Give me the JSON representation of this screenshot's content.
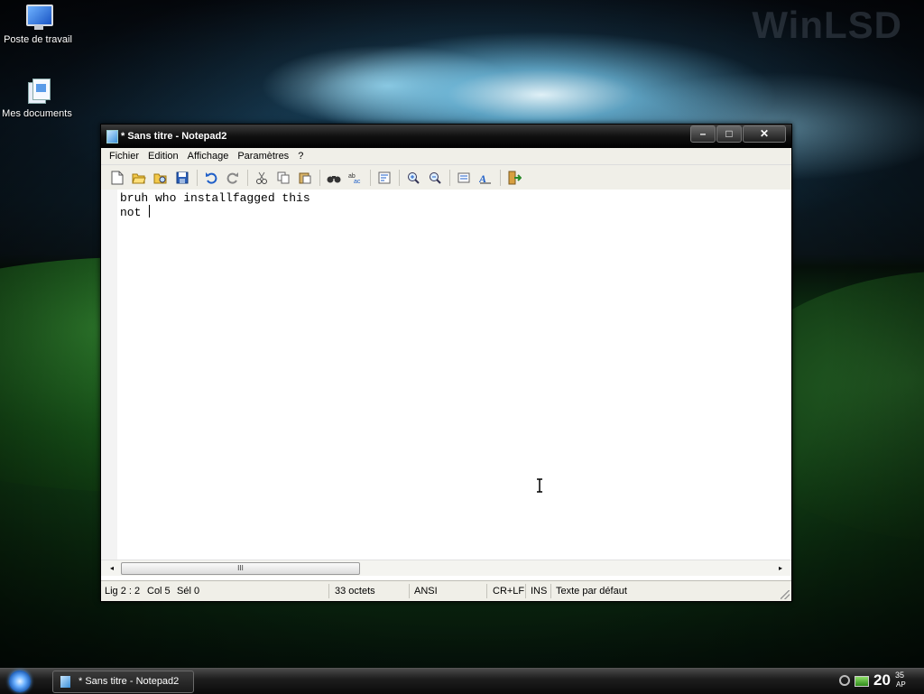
{
  "desktop": {
    "brand": "WinLSD",
    "icons": [
      {
        "label": "Poste de travail",
        "icon": "computer-icon"
      },
      {
        "label": "Mes documents",
        "icon": "documents-icon"
      }
    ]
  },
  "window": {
    "title": "* Sans titre - Notepad2",
    "controls": {
      "minimize": "–",
      "maximize": "□",
      "close": "✕"
    },
    "menu": [
      "Fichier",
      "Edition",
      "Affichage",
      "Paramètres",
      "?"
    ],
    "editor": {
      "line1": "bruh who installfagged this",
      "line2": "not "
    },
    "status": {
      "position": "Lig 2 : 2",
      "column": "Col 5",
      "selection": "Sél 0",
      "size": "33 octets",
      "encoding": "ANSI",
      "line_ending": "CR+LF",
      "mode": "INS",
      "scheme": "Texte par défaut"
    },
    "scrollbar": {
      "left": "◂",
      "right": "▸",
      "grip": "III"
    }
  },
  "taskbar": {
    "task": "* Sans titre - Notepad2",
    "clock": {
      "hour": "20",
      "minute": "35",
      "suffix": "AP"
    }
  }
}
